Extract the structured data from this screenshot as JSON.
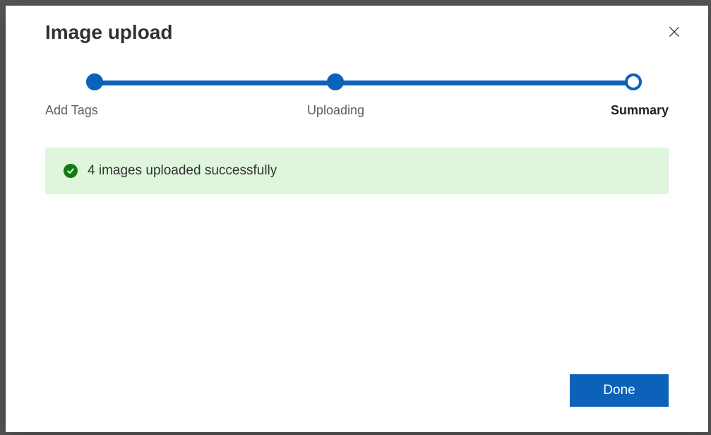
{
  "modal": {
    "title": "Image upload",
    "steps": [
      {
        "label": "Add Tags",
        "state": "complete"
      },
      {
        "label": "Uploading",
        "state": "complete"
      },
      {
        "label": "Summary",
        "state": "current"
      }
    ],
    "status": {
      "type": "success",
      "message": "4 images uploaded successfully"
    },
    "actions": {
      "done_label": "Done"
    }
  }
}
